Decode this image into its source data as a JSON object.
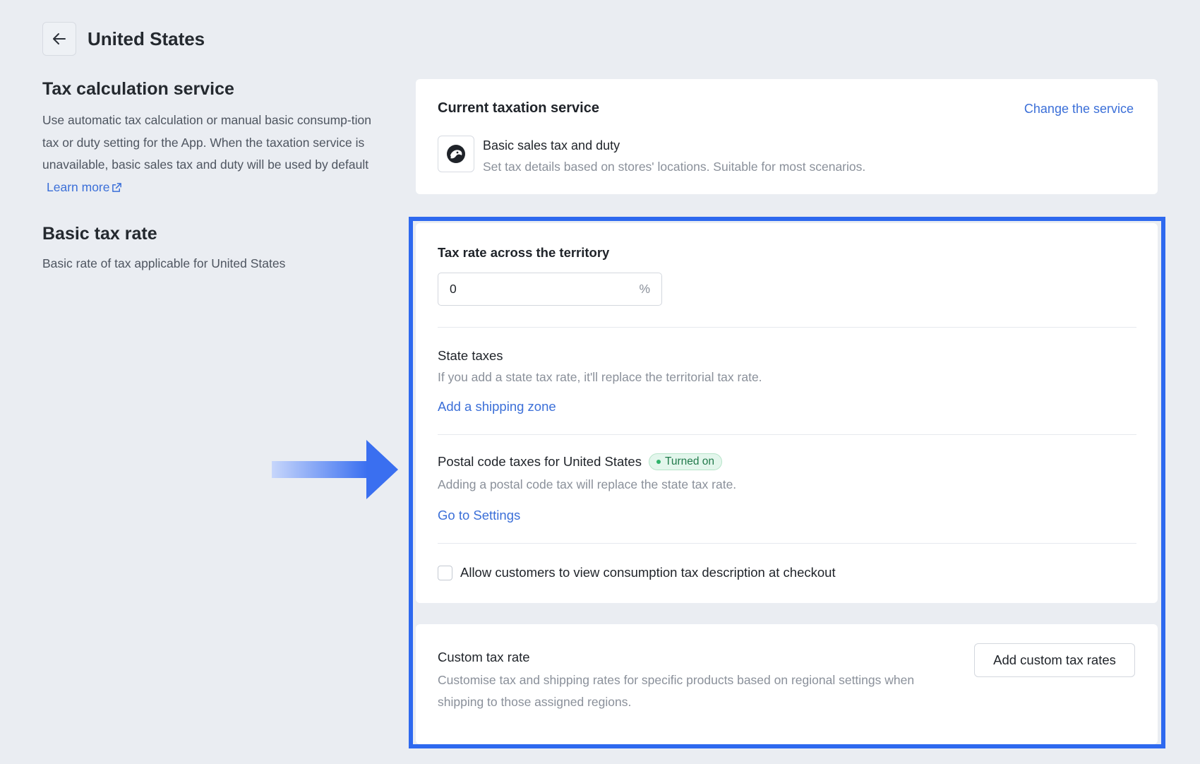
{
  "header": {
    "title": "United States",
    "back_icon": "arrow-left-icon"
  },
  "left": {
    "tax_service": {
      "title": "Tax calculation service",
      "description": "Use automatic tax calculation or manual basic consump-tion tax or duty setting for the App. When the taxation service is unavailable, basic sales tax and duty will be used by default",
      "learn_more": "Learn more"
    },
    "basic_rate": {
      "title": "Basic tax rate",
      "description": "Basic rate of tax applicable for United States"
    }
  },
  "service_card": {
    "heading": "Current taxation service",
    "change_link": "Change the service",
    "service_name": "Basic sales tax and duty",
    "service_desc": "Set tax details based on stores' locations. Suitable for most scenarios."
  },
  "main_card": {
    "tax_rate_label": "Tax rate across the territory",
    "tax_rate_value": "0",
    "tax_rate_unit": "%",
    "state_taxes_title": "State taxes",
    "state_taxes_desc": "If you add a state tax rate, it'll replace the territorial tax rate.",
    "state_taxes_link": "Add a shipping zone",
    "postal_title": "Postal code taxes for United States",
    "postal_badge": "Turned on",
    "postal_desc": "Adding a postal code tax will replace the state tax rate.",
    "postal_link": "Go to Settings",
    "checkbox_label": "Allow customers to view consumption tax description at checkout",
    "checkbox_checked": false
  },
  "custom_card": {
    "title": "Custom tax rate",
    "description": "Customise tax and shipping rates for specific products based on regional settings when shipping to those assigned regions.",
    "button": "Add custom tax rates"
  },
  "colors": {
    "accent": "#3b6fd8",
    "highlight": "#2e69ef",
    "badge_bg": "#e3f6ec",
    "badge_text": "#217a4b",
    "background": "#eaedf2"
  }
}
